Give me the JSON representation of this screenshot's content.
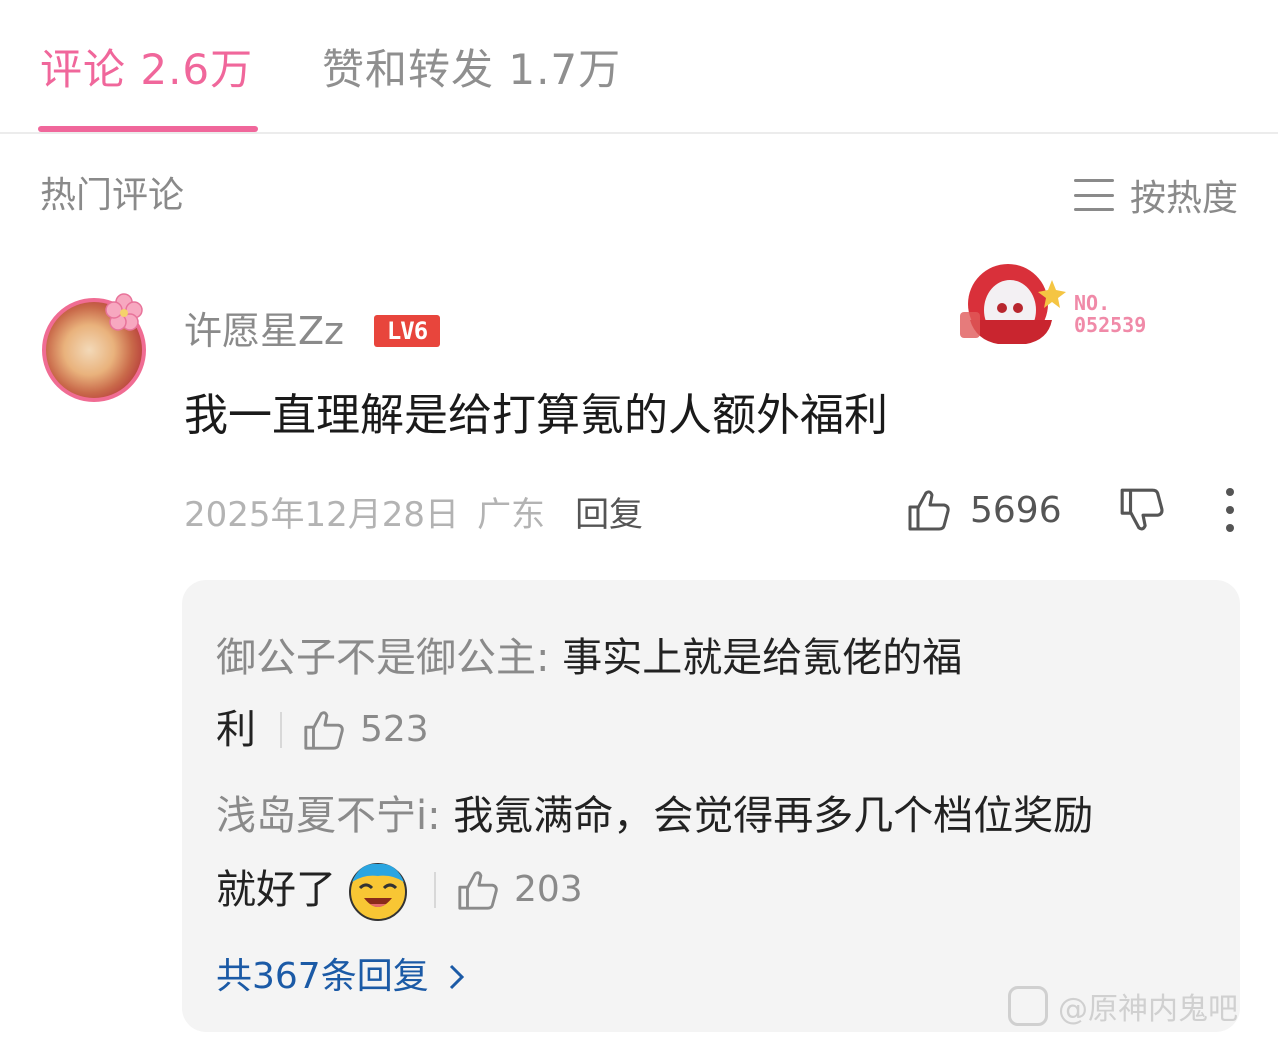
{
  "tabs": {
    "comments": "评论 2.6万",
    "likes_reposts": "赞和转发 1.7万"
  },
  "section": {
    "title": "热门评论",
    "sort_label": "按热度"
  },
  "comment": {
    "username": "许愿星Zz",
    "level": "LV6",
    "fan_badge_no": "NO.",
    "fan_badge_number": "052539",
    "text": "我一直理解是给打算氪的人额外福利",
    "date": "2025年12月28日",
    "region": "广东",
    "reply_label": "回复",
    "likes": "5696"
  },
  "replies": {
    "items": [
      {
        "author": "御公子不是御公主:",
        "text_line1": " 事实上就是给氪佬的福",
        "text_line2": "利",
        "likes": "523"
      },
      {
        "author": "浅岛夏不宁i:",
        "text_line1": " 我氪满命，会觉得再多几个档位奖励",
        "text_line2": "就好了",
        "likes": "203"
      }
    ],
    "total": "共367条回复"
  },
  "watermark": "@原神内鬼吧"
}
